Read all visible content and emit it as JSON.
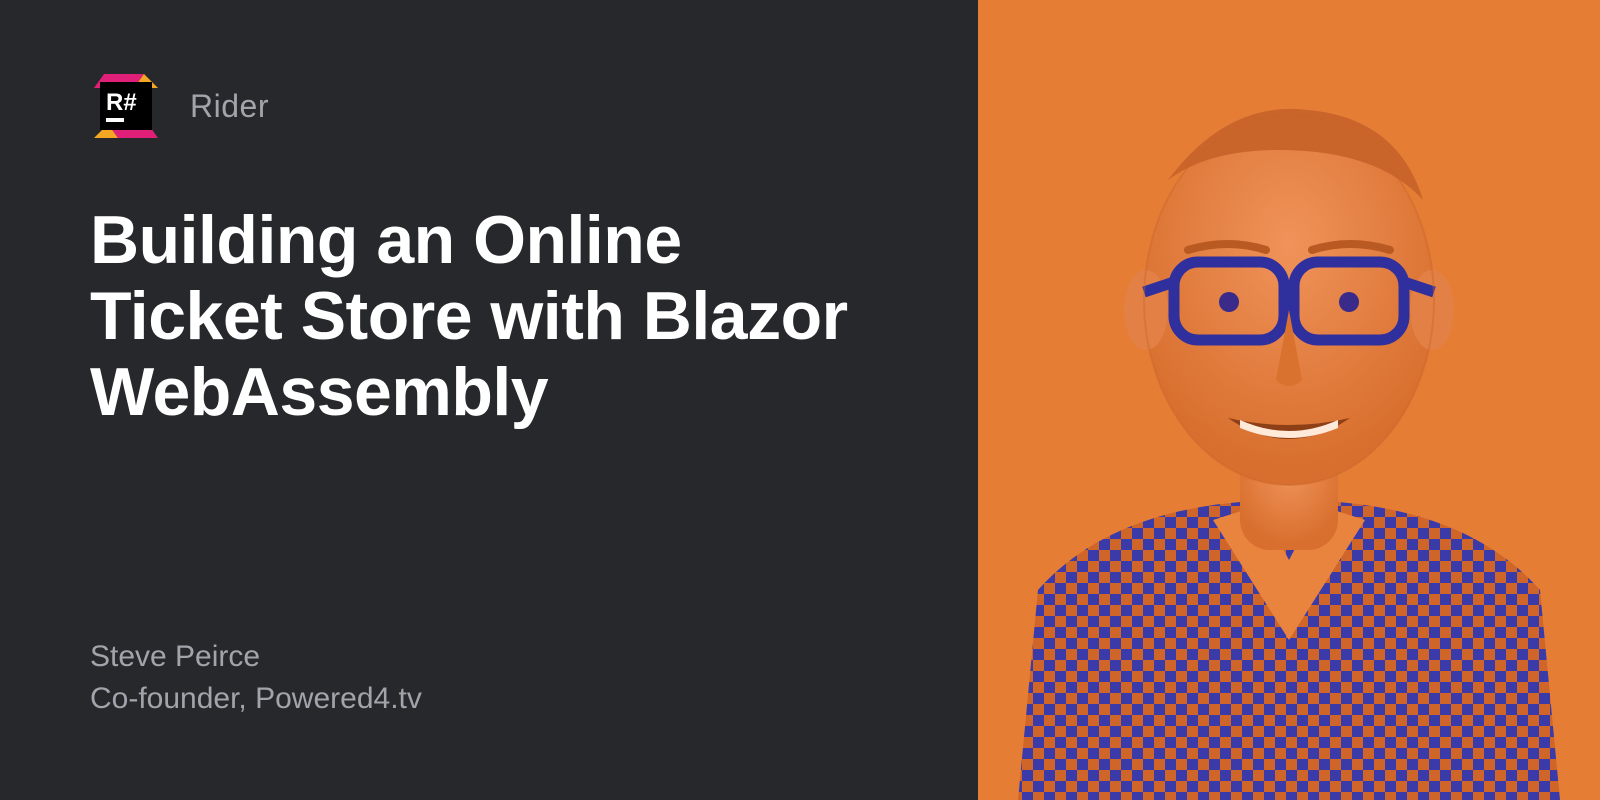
{
  "brand": {
    "product": "Rider",
    "logo_text": "R#"
  },
  "headline": "Building an Online Ticket Store with Blazor WebAssembly",
  "speaker": {
    "name": "Steve Peirce",
    "role": "Co-founder, Powered4.tv"
  },
  "colors": {
    "panel_bg": "#27282c",
    "photo_bg": "#e57d35",
    "text_muted": "#a1a4ab",
    "logo_magenta": "#e01f78",
    "logo_orange": "#f5a623"
  }
}
